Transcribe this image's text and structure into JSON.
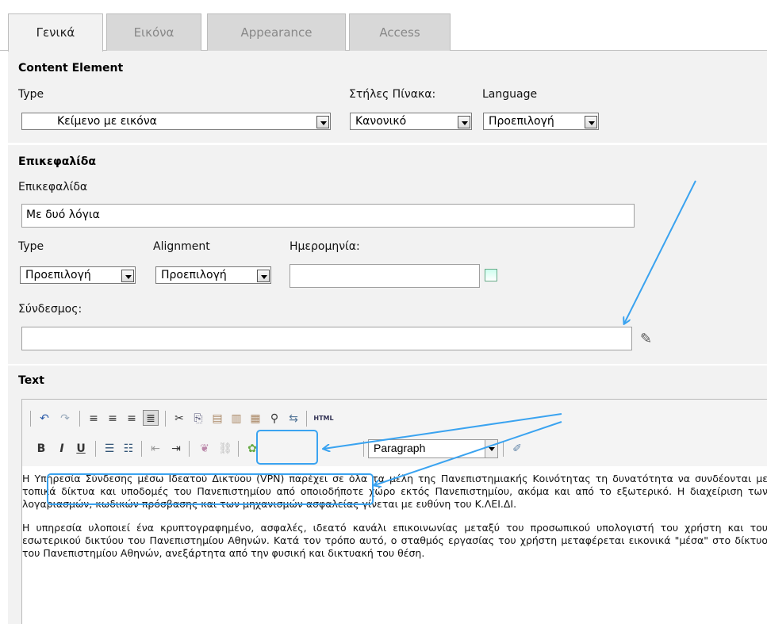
{
  "tabs": [
    {
      "label": "Γενικά",
      "active": true
    },
    {
      "label": "Εικόνα",
      "active": false
    },
    {
      "label": "Appearance",
      "active": false
    },
    {
      "label": "Access",
      "active": false
    }
  ],
  "content_element": {
    "title": "Content Element",
    "type_label": "Type",
    "type_value": "Κείμενο με εικόνα",
    "table_cols_label": "Στήλες Πίνακα:",
    "table_cols_value": "Κανονικό",
    "language_label": "Language",
    "language_value": "Προεπιλογή"
  },
  "header": {
    "title": "Επικεφαλίδα",
    "header_label": "Επικεφαλίδα",
    "header_value": "Με δυό λόγια",
    "type_label": "Type",
    "type_value": "Προεπιλογή",
    "alignment_label": "Alignment",
    "alignment_value": "Προεπιλογή",
    "date_label": "Ημερομηνία:",
    "date_value": "",
    "link_label": "Σύνδεσμος:",
    "link_value": ""
  },
  "text": {
    "title": "Text",
    "toolbar": {
      "html_label": "HTML",
      "bold": "B",
      "italic": "I",
      "underline": "U",
      "format_value": "Paragraph"
    },
    "paragraphs": [
      "Η Υπηρεσία Σύνδεσης μέσω Ιδεατού Δικτύου (VPN) παρέχει σε όλα τα μέλη της Πανεπιστημιακής Κοινότητας τη δυνατότητα να συνδέονται με τοπικά δίκτυα και υποδομές του Πανεπιστημίου από οποιοδήποτε χώρο εκτός Πανεπιστημίου, ακόμα και από το εξωτερικό. Η διαχείριση των λογαριασμών, κωδικών πρόσβασης και των μηχανισμών ασφαλείας γίνεται με ευθύνη του Κ.ΛΕΙ.ΔΙ.",
      "Η υπηρεσία υλοποιεί ένα κρυπτογραφημένο, ασφαλές, ιδεατό κανάλι επικοινωνίας μεταξύ του προσωπικού υπολογιστή του χρήστη και του εσωτερικού δικτύου του Πανεπιστημίου Αθηνών. Κατά τον τρόπο αυτό, ο σταθμός εργασίας του χρήστη μεταφέρεται εικονικά \"μέσα\" στο δίκτυο του Πανεπιστημίου Αθηνών, ανεξάρτητα από την φυσική και δικτυακή του θέση."
    ]
  },
  "annotation_color": "#3aa3f0"
}
